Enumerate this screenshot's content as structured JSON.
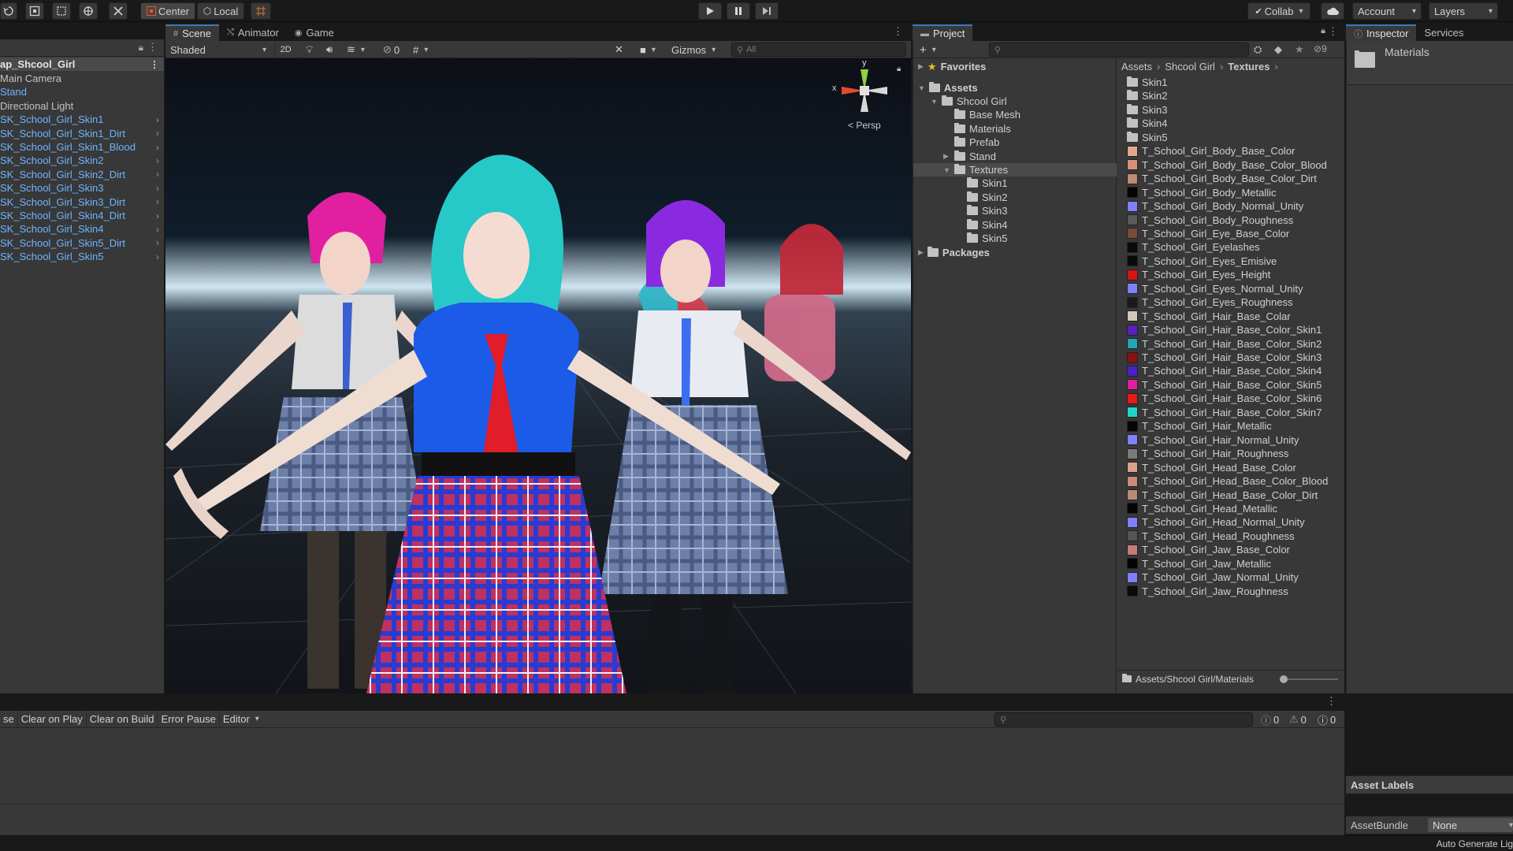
{
  "toolbar": {
    "pivot_label": "Center",
    "space_label": "Local",
    "collab_label": "Collab",
    "account_label": "Account",
    "layers_label": "Layers"
  },
  "tabs": {
    "scene": "Scene",
    "animator": "Animator",
    "game": "Game",
    "project": "Project",
    "inspector": "Inspector",
    "services": "Services"
  },
  "scene_toolbar": {
    "shading_mode": "Shaded",
    "two_d": "2D",
    "hidden_count": "0",
    "gizmos": "Gizmos",
    "search_placeholder": "All",
    "persp_label": "Persp",
    "axis_x": "x",
    "axis_y": "y"
  },
  "hierarchy": {
    "scene_name": "ap_Shcool_Girl",
    "items": [
      {
        "label": "Main Camera",
        "blue": false,
        "arrow": false
      },
      {
        "label": "Stand",
        "blue": true,
        "arrow": false
      },
      {
        "label": "Directional Light",
        "blue": false,
        "arrow": false
      },
      {
        "label": "SK_School_Girl_Skin1",
        "blue": true,
        "arrow": true
      },
      {
        "label": "SK_School_Girl_Skin1_Dirt",
        "blue": true,
        "arrow": true
      },
      {
        "label": "SK_School_Girl_Skin1_Blood",
        "blue": true,
        "arrow": true
      },
      {
        "label": "SK_School_Girl_Skin2",
        "blue": true,
        "arrow": true
      },
      {
        "label": "SK_School_Girl_Skin2_Dirt",
        "blue": true,
        "arrow": true
      },
      {
        "label": "SK_School_Girl_Skin3",
        "blue": true,
        "arrow": true
      },
      {
        "label": "SK_School_Girl_Skin3_Dirt",
        "blue": true,
        "arrow": true
      },
      {
        "label": "SK_School_Girl_Skin4_Dirt",
        "blue": true,
        "arrow": true
      },
      {
        "label": "SK_School_Girl_Skin4",
        "blue": true,
        "arrow": true
      },
      {
        "label": "SK_School_Girl_Skin5_Dirt",
        "blue": true,
        "arrow": true
      },
      {
        "label": "SK_School_Girl_Skin5",
        "blue": true,
        "arrow": true
      }
    ]
  },
  "project": {
    "hidden_count": "9",
    "favorites": "Favorites",
    "assets": "Assets",
    "packages": "Packages",
    "tree": [
      {
        "label": "Shcool Girl",
        "depth": 1,
        "arrow": "open"
      },
      {
        "label": "Base Mesh",
        "depth": 2,
        "arrow": ""
      },
      {
        "label": "Materials",
        "depth": 2,
        "arrow": ""
      },
      {
        "label": "Prefab",
        "depth": 2,
        "arrow": ""
      },
      {
        "label": "Stand",
        "depth": 2,
        "arrow": "closed"
      },
      {
        "label": "Textures",
        "depth": 2,
        "arrow": "open"
      },
      {
        "label": "Skin1",
        "depth": 3,
        "arrow": ""
      },
      {
        "label": "Skin2",
        "depth": 3,
        "arrow": ""
      },
      {
        "label": "Skin3",
        "depth": 3,
        "arrow": ""
      },
      {
        "label": "Skin4",
        "depth": 3,
        "arrow": ""
      },
      {
        "label": "Skin5",
        "depth": 3,
        "arrow": ""
      }
    ],
    "breadcrumb": [
      "Assets",
      "Shcool Girl",
      "Textures"
    ],
    "files": [
      {
        "label": "Skin1",
        "kind": "folder"
      },
      {
        "label": "Skin2",
        "kind": "folder"
      },
      {
        "label": "Skin3",
        "kind": "folder"
      },
      {
        "label": "Skin4",
        "kind": "folder"
      },
      {
        "label": "Skin5",
        "kind": "folder"
      },
      {
        "label": "T_School_Girl_Body_Base_Color",
        "kind": "tex",
        "color": "#e3a58c"
      },
      {
        "label": "T_School_Girl_Body_Base_Color_Blood",
        "kind": "tex",
        "color": "#d98f7a"
      },
      {
        "label": "T_School_Girl_Body_Base_Color_Dirt",
        "kind": "tex",
        "color": "#c08a73"
      },
      {
        "label": "T_School_Girl_Body_Metallic",
        "kind": "tex",
        "color": "#050505"
      },
      {
        "label": "T_School_Girl_Body_Normal_Unity",
        "kind": "tex",
        "color": "#8080ff"
      },
      {
        "label": "T_School_Girl_Body_Roughness",
        "kind": "tex",
        "color": "#5a5a5a"
      },
      {
        "label": "T_School_Girl_Eye_Base_Color",
        "kind": "tex",
        "color": "#7a4a3a"
      },
      {
        "label": "T_School_Girl_Eyelashes",
        "kind": "tex",
        "color": "#0a0a0a"
      },
      {
        "label": "T_School_Girl_Eyes_Emisive",
        "kind": "tex",
        "color": "#0a0a0a"
      },
      {
        "label": "T_School_Girl_Eyes_Height",
        "kind": "tex",
        "color": "#d81414"
      },
      {
        "label": "T_School_Girl_Eyes_Normal_Unity",
        "kind": "tex",
        "color": "#8080ff"
      },
      {
        "label": "T_School_Girl_Eyes_Roughness",
        "kind": "tex",
        "color": "#1a1a1a"
      },
      {
        "label": "T_School_Girl_Hair_Base_Colar",
        "kind": "tex",
        "color": "#cfc8b8"
      },
      {
        "label": "T_School_Girl_Hair_Base_Color_Skin1",
        "kind": "tex",
        "color": "#5a1fbf"
      },
      {
        "label": "T_School_Girl_Hair_Base_Color_Skin2",
        "kind": "tex",
        "color": "#1fa7b5"
      },
      {
        "label": "T_School_Girl_Hair_Base_Color_Skin3",
        "kind": "tex",
        "color": "#8a1010"
      },
      {
        "label": "T_School_Girl_Hair_Base_Color_Skin4",
        "kind": "tex",
        "color": "#4b1fc9"
      },
      {
        "label": "T_School_Girl_Hair_Base_Color_Skin5",
        "kind": "tex",
        "color": "#e01fa0"
      },
      {
        "label": "T_School_Girl_Hair_Base_Color_Skin6",
        "kind": "tex",
        "color": "#e81a1a"
      },
      {
        "label": "T_School_Girl_Hair_Base_Color_Skin7",
        "kind": "tex",
        "color": "#1fd6c8"
      },
      {
        "label": "T_School_Girl_Hair_Metallic",
        "kind": "tex",
        "color": "#050505"
      },
      {
        "label": "T_School_Girl_Hair_Normal_Unity",
        "kind": "tex",
        "color": "#8080ff"
      },
      {
        "label": "T_School_Girl_Hair_Roughness",
        "kind": "tex",
        "color": "#7a7a7a"
      },
      {
        "label": "T_School_Girl_Head_Base_Color",
        "kind": "tex",
        "color": "#d9a08a"
      },
      {
        "label": "T_School_Girl_Head_Base_Color_Blood",
        "kind": "tex",
        "color": "#c98a78"
      },
      {
        "label": "T_School_Girl_Head_Base_Color_Dirt",
        "kind": "tex",
        "color": "#b88a78"
      },
      {
        "label": "T_School_Girl_Head_Metallic",
        "kind": "tex",
        "color": "#050505"
      },
      {
        "label": "T_School_Girl_Head_Normal_Unity",
        "kind": "tex",
        "color": "#8080ff"
      },
      {
        "label": "T_School_Girl_Head_Roughness",
        "kind": "tex",
        "color": "#555555"
      },
      {
        "label": "T_School_Girl_Jaw_Base_Color",
        "kind": "tex",
        "color": "#c87a7a"
      },
      {
        "label": "T_School_Girl_Jaw_Metallic",
        "kind": "tex",
        "color": "#050505"
      },
      {
        "label": "T_School_Girl_Jaw_Normal_Unity",
        "kind": "tex",
        "color": "#8080ff"
      },
      {
        "label": "T_School_Girl_Jaw_Roughness",
        "kind": "tex",
        "color": "#0a0a0a"
      }
    ],
    "footer_path": "Assets/Shcool Girl/Materials"
  },
  "inspector": {
    "selected_name": "Materials",
    "asset_labels": "Asset Labels",
    "assetbundle_label": "AssetBundle",
    "assetbundle_value": "None"
  },
  "console": {
    "collapse": "se",
    "clear_on_play": "Clear on Play",
    "clear_on_build": "Clear on Build",
    "error_pause": "Error Pause",
    "editor": "Editor",
    "info_count": "0",
    "warn_count": "0",
    "error_count": "0"
  },
  "status": {
    "right_text": "Auto Generate Lig"
  }
}
